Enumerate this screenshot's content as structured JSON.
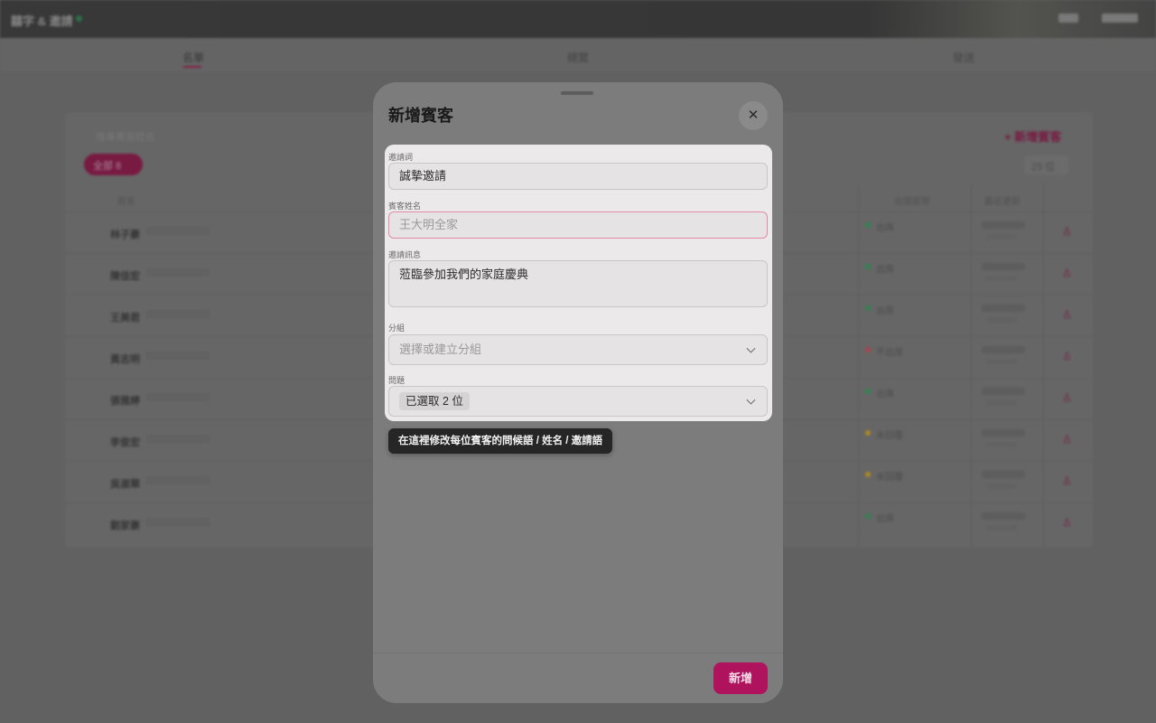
{
  "background": {
    "brand": "囍字 & 邀請",
    "tabs": [
      "名單",
      "總覽",
      "發送"
    ],
    "search_placeholder": "搜尋賓客姓名",
    "filter_chip": "全部 8",
    "add_guest": "+ 新增賓客",
    "count": "25 位",
    "columns": [
      "姓名",
      "出席狀態",
      "最近更新"
    ],
    "rows": [
      {
        "name": "林子豪",
        "status_color": "#2f9a5a",
        "status": "出席"
      },
      {
        "name": "陳佳宏",
        "status_color": "#2f9a5a",
        "status": "出席"
      },
      {
        "name": "王美君",
        "status_color": "#2f9a5a",
        "status": "出席"
      },
      {
        "name": "黃志明",
        "status_color": "#c94a5a",
        "status": "不出席"
      },
      {
        "name": "張雅婷",
        "status_color": "#2f9a5a",
        "status": "出席"
      },
      {
        "name": "李俊宏",
        "status_color": "#c9a020",
        "status": "未回覆"
      },
      {
        "name": "吳淑華",
        "status_color": "#c9a020",
        "status": "未回覆"
      },
      {
        "name": "劉家豪",
        "status_color": "#2f9a5a",
        "status": "出席"
      }
    ]
  },
  "modal": {
    "title": "新增賓客",
    "close_symbol": "✕",
    "submit_label": "新增",
    "fields": {
      "invite_word": {
        "label": "邀請詞",
        "value": "誠摯邀請"
      },
      "guest_name": {
        "label": "賓客姓名",
        "placeholder": "王大明全家"
      },
      "invite_message": {
        "label": "邀請訊息",
        "value": "蒞臨參加我們的家庭慶典"
      },
      "group": {
        "label": "分組",
        "placeholder": "選擇或建立分組"
      },
      "question": {
        "label": "問題",
        "selected": "已選取 2 位"
      }
    },
    "tooltip": "在這裡修改每位賓客的問候語 / 姓名 / 邀請語"
  },
  "colors": {
    "accent": "#b0135e",
    "error_border": "#e38aa9"
  }
}
